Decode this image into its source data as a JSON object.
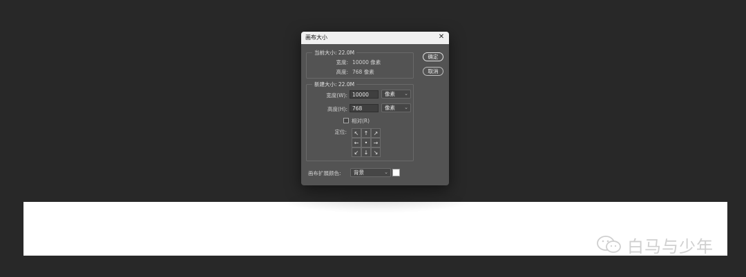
{
  "dialog": {
    "title": "画布大小",
    "close_glyph": "✕",
    "current_size": {
      "legend": "当前大小: 22.0M",
      "width_label": "宽度:",
      "width_value": "10000 像素",
      "height_label": "高度:",
      "height_value": "768 像素"
    },
    "new_size": {
      "legend": "新建大小: 22.0M",
      "width_label": "宽度(W):",
      "width_value": "10000",
      "width_unit": "像素",
      "height_label": "高度(H):",
      "height_value": "768",
      "height_unit": "像素",
      "relative_label": "相对(R)",
      "relative_checked": false,
      "anchor_label": "定位:",
      "anchor_cells": [
        "↖",
        "↑",
        "↗",
        "←",
        "•",
        "→",
        "↙",
        "↓",
        "↘"
      ]
    },
    "extension_color": {
      "label": "画布扩展颜色:",
      "value": "背景",
      "swatch_color": "#ffffff"
    },
    "buttons": {
      "ok": "确定",
      "cancel": "取消"
    }
  },
  "watermark": {
    "icon": "wechat-icon",
    "text": "白马与少年"
  }
}
